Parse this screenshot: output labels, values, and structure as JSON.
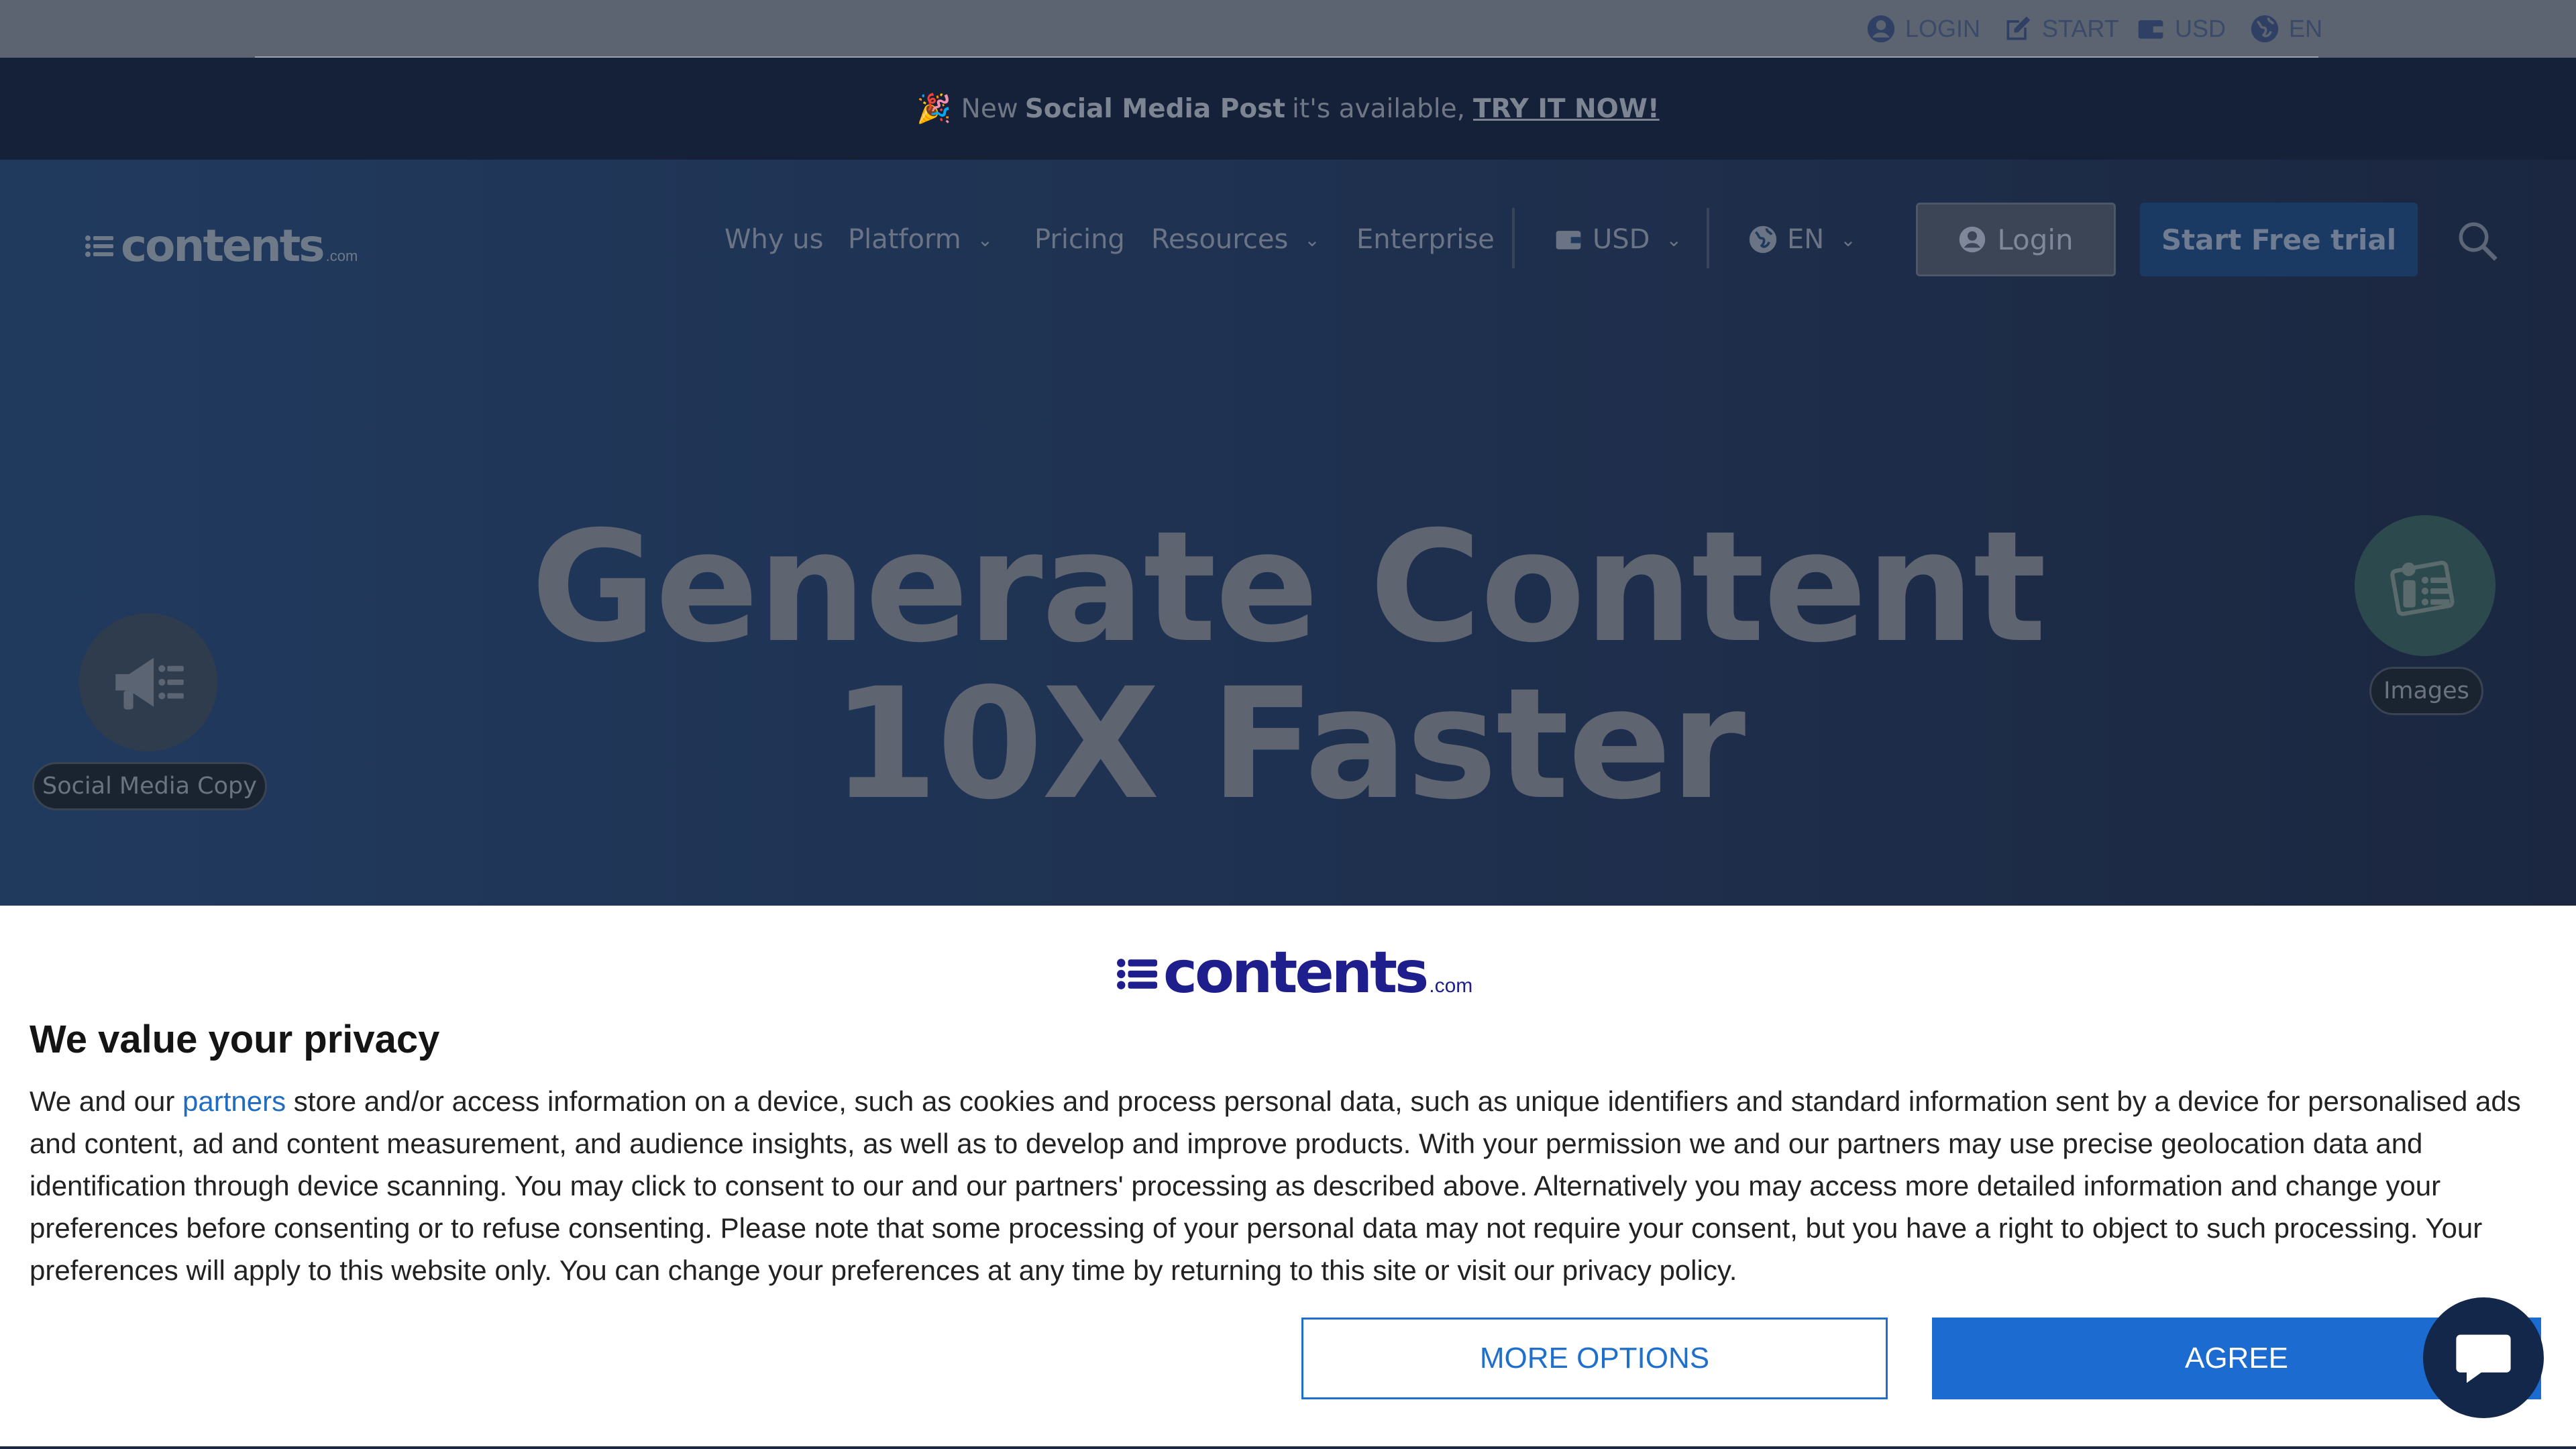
{
  "topbar": {
    "login": "LOGIN",
    "start": "START",
    "currency": "USD",
    "language": "EN"
  },
  "announcement": {
    "prefix": "New",
    "product": "Social Media Post",
    "middle": "it's available,",
    "cta": "TRY IT NOW!"
  },
  "header": {
    "logo_word": "contents",
    "logo_tld": ".com",
    "nav": {
      "why_us": "Why us",
      "platform": "Platform",
      "pricing": "Pricing",
      "resources": "Resources",
      "enterprise": "Enterprise"
    },
    "currency": "USD",
    "language": "EN",
    "login_label": "Login",
    "trial_label": "Start Free trial"
  },
  "hero": {
    "headline_line1": "Generate Content",
    "headline_line2": "10X Faster",
    "left_badge": "Social Media Copy",
    "right_badge": "Images"
  },
  "consent": {
    "logo_word": "contents",
    "logo_tld": ".com",
    "title": "We value your privacy",
    "body_start": "We and our ",
    "partners_link": "partners",
    "body_rest": " store and/or access information on a device, such as cookies and process personal data, such as unique identifiers and standard information sent by a device for personalised ads and content, ad and content measurement, and audience insights, as well as to develop and improve products. With your permission we and our partners may use precise geolocation data and identification through device scanning. You may click to consent to our and our partners' processing as described above. Alternatively you may access more detailed information and change your preferences before consenting or to refuse consenting. Please note that some processing of your personal data may not require your consent, but you have a right to object to such processing. Your preferences will apply to this website only. You can change your preferences at any time by returning to this site or visit our privacy policy.",
    "more_options": "MORE OPTIONS",
    "agree": "AGREE"
  },
  "colors": {
    "consent_accent": "#1c6bd0",
    "hero_bg": "#1f3150",
    "announcement_bg": "#152039"
  },
  "icons": [
    "user-circle-icon",
    "edit-icon",
    "wallet-icon",
    "globe-icon",
    "party-popper-icon",
    "chevron-down-icon",
    "search-icon",
    "megaphone-icon",
    "images-icon",
    "chat-icon"
  ]
}
